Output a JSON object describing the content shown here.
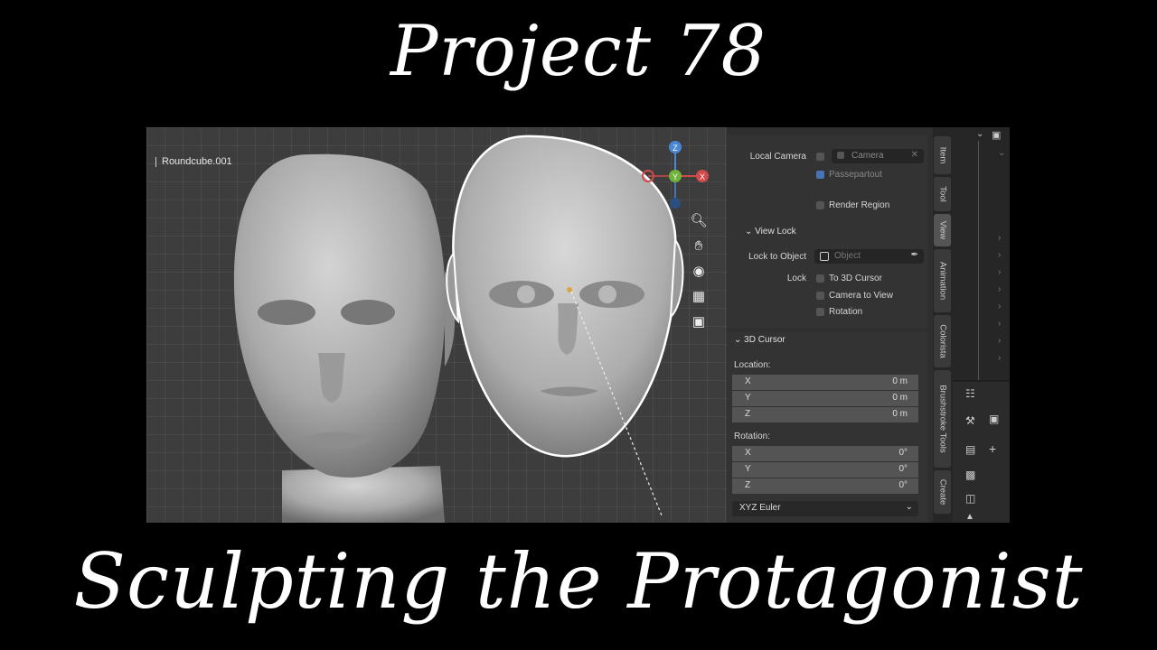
{
  "titles": {
    "top": "Project 78",
    "bottom": "Sculpting the Protagonist"
  },
  "viewport": {
    "object_name": "Roundcube.001",
    "gizmo": {
      "z": "Z",
      "y": "Y",
      "x": "X"
    },
    "tool_icons": [
      "zoom-icon",
      "hand-pan-icon",
      "camera-icon",
      "grid-icon",
      "frame-icon"
    ]
  },
  "properties": {
    "local_camera_label": "Local Camera",
    "camera_value": "Camera",
    "passepartout_label": "Passepartout",
    "render_region_label": "Render Region",
    "view_lock_header": "View Lock",
    "lock_to_object_label": "Lock to Object",
    "object_placeholder": "Object",
    "lock_label": "Lock",
    "to_3d_cursor_label": "To 3D Cursor",
    "camera_to_view_label": "Camera to View",
    "rotation_label": "Rotation",
    "cursor_header": "3D Cursor",
    "location_label": "Location:",
    "location": [
      {
        "axis": "X",
        "value": "0 m"
      },
      {
        "axis": "Y",
        "value": "0 m"
      },
      {
        "axis": "Z",
        "value": "0 m"
      }
    ],
    "rotation_section_label": "Rotation:",
    "rotation": [
      {
        "axis": "X",
        "value": "0°"
      },
      {
        "axis": "Y",
        "value": "0°"
      },
      {
        "axis": "Z",
        "value": "0°"
      }
    ],
    "rotation_mode": "XYZ Euler"
  },
  "tabs": [
    "Item",
    "Tool",
    "View",
    "Animation",
    "Colorista",
    "Brushstroke Tools",
    "Create"
  ],
  "active_tab": "View"
}
